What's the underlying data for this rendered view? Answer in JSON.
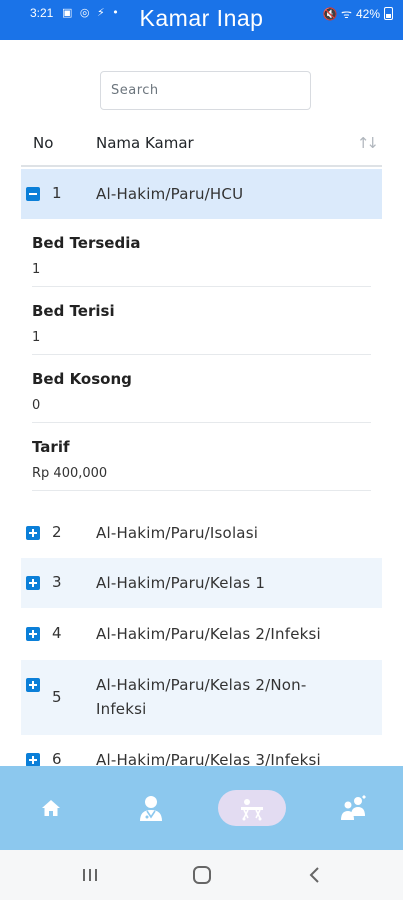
{
  "status_bar": {
    "time": "3:21",
    "left_icons": "▣ ◎ ⚡ •",
    "right_icons": "🔇 ᯤ",
    "battery": "42%"
  },
  "header": {
    "title": "Kamar Inap"
  },
  "search": {
    "placeholder": "Search",
    "value": ""
  },
  "table": {
    "columns": {
      "no": "No",
      "nama": "Nama Kamar"
    },
    "rows": [
      {
        "no": "1",
        "nama": "Al-Hakim/Paru/HCU",
        "expanded": true
      },
      {
        "no": "2",
        "nama": "Al-Hakim/Paru/Isolasi",
        "expanded": false
      },
      {
        "no": "3",
        "nama": "Al-Hakim/Paru/Kelas 1",
        "expanded": false
      },
      {
        "no": "4",
        "nama": "Al-Hakim/Paru/Kelas 2/Infeksi",
        "expanded": false
      },
      {
        "no": "5",
        "nama": "Al-Hakim/Paru/Kelas 2/Non-Infeksi",
        "expanded": false
      },
      {
        "no": "6",
        "nama": "Al-Hakim/Paru/Kelas 3/Infeksi",
        "expanded": false
      }
    ],
    "detail": [
      {
        "label": "Bed Tersedia",
        "value": "1"
      },
      {
        "label": "Bed Terisi",
        "value": "1"
      },
      {
        "label": "Bed Kosong",
        "value": "0"
      },
      {
        "label": "Tarif",
        "value": "Rp 400,000"
      }
    ]
  },
  "tabbar": {
    "tabs": [
      {
        "icon": "home-icon",
        "selected": false
      },
      {
        "icon": "doctor-icon",
        "selected": false
      },
      {
        "icon": "hospital-bed-icon",
        "selected": true
      },
      {
        "icon": "visitor-icon",
        "selected": false
      }
    ]
  },
  "colors": {
    "header": "#1a73e8",
    "tabbar": "#8cc8ee",
    "row_highlight": "#dbeafb",
    "toggle": "#0b7fd8"
  }
}
